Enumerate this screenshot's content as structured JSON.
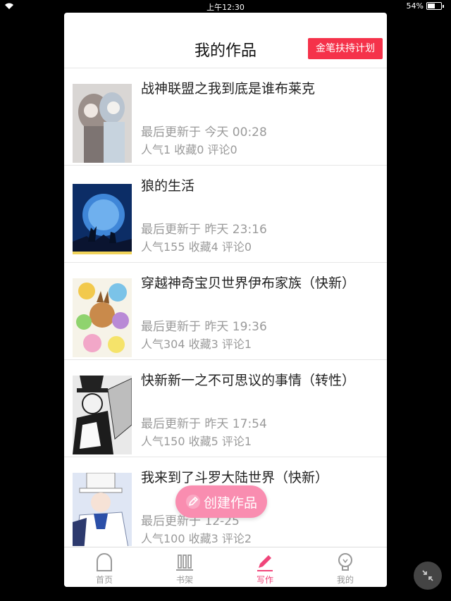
{
  "status_bar": {
    "time": "上午12:30",
    "battery": "54%",
    "battery_level": 0.54
  },
  "header": {
    "title": "我的作品",
    "plan_button": "金笔扶持计划"
  },
  "works": [
    {
      "title": "战神联盟之我到底是谁布莱克",
      "updated": "最后更新于 今天 00:28",
      "stats": "人气1 收藏0 评论0"
    },
    {
      "title": "狼的生活",
      "updated": "最后更新于 昨天 23:16",
      "stats": "人气155 收藏4 评论0"
    },
    {
      "title": "穿越神奇宝贝世界伊布家族（快新）",
      "updated": "最后更新于 昨天 19:36",
      "stats": "人气304 收藏3 评论1"
    },
    {
      "title": "快新新一之不可思议的事情（转性）",
      "updated": "最后更新于 昨天 17:54",
      "stats": "人气150 收藏5 评论1"
    },
    {
      "title": "我来到了斗罗大陆世界（快新）",
      "updated": "最后更新于 12-25",
      "stats": "人气100 收藏3 评论2"
    }
  ],
  "create_button": {
    "label": "创建作品",
    "icon": "pencil-icon"
  },
  "tabs": [
    {
      "label": "首页",
      "icon": "home-icon"
    },
    {
      "label": "书架",
      "icon": "bookshelf-icon"
    },
    {
      "label": "写作",
      "icon": "pen-icon",
      "active": true
    },
    {
      "label": "我的",
      "icon": "lightbulb-icon"
    }
  ],
  "colors": {
    "accent": "#f0457a",
    "plan_button": "#f5324a",
    "create_button": "#f98db0"
  }
}
